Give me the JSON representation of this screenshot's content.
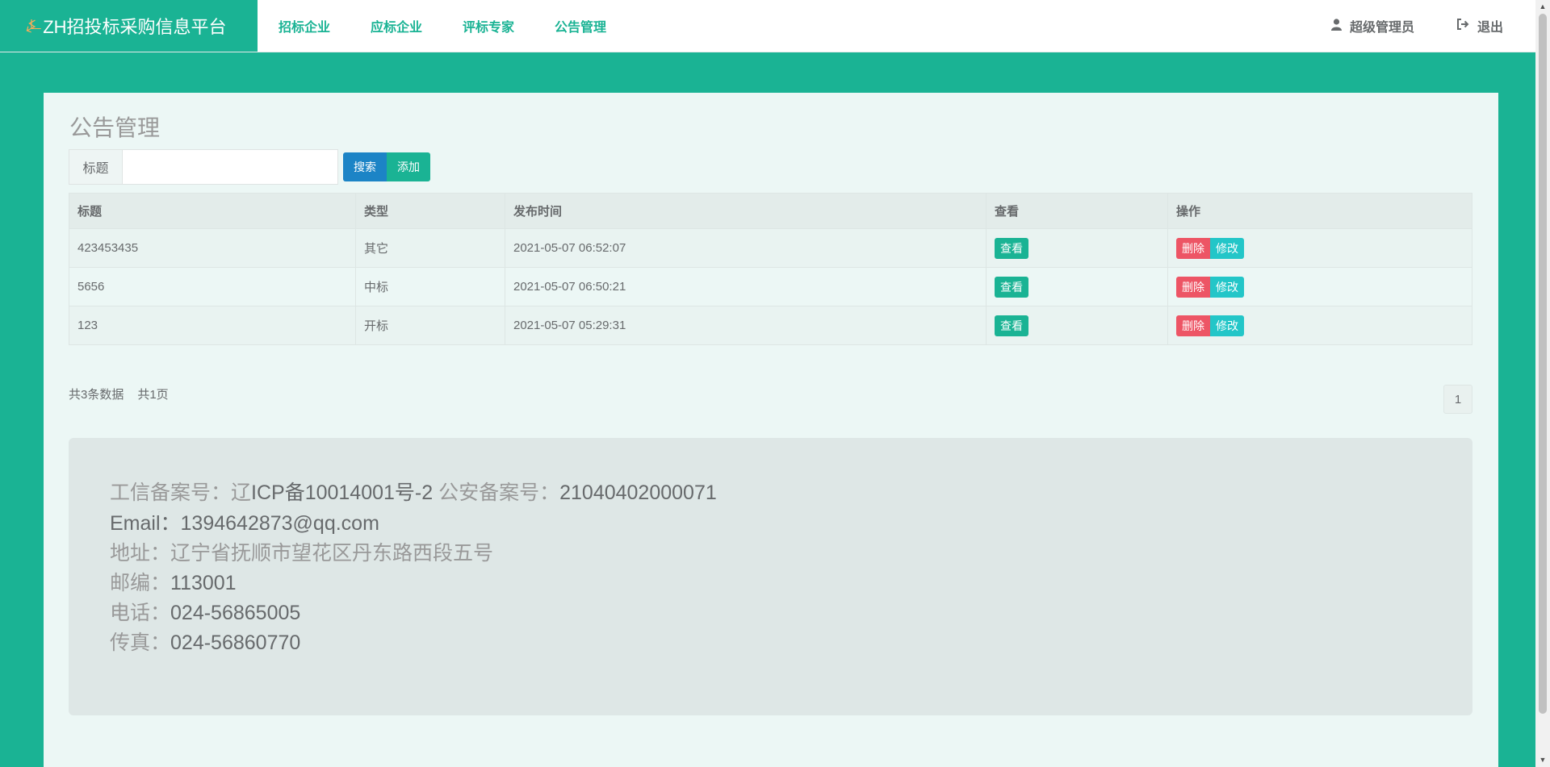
{
  "brand": {
    "title": "ZH招投标采购信息平台",
    "logo": "⍼"
  },
  "nav": [
    {
      "label": "招标企业"
    },
    {
      "label": "应标企业"
    },
    {
      "label": "评标专家"
    },
    {
      "label": "公告管理"
    }
  ],
  "user": {
    "name": "超级管理员",
    "logout": "退出"
  },
  "page": {
    "title": "公告管理"
  },
  "search": {
    "label": "标题",
    "value": "",
    "search_btn": "搜索",
    "add_btn": "添加"
  },
  "table": {
    "headers": [
      "标题",
      "类型",
      "发布时间",
      "查看",
      "操作"
    ],
    "rows": [
      {
        "title": "423453435",
        "type": "其它",
        "time": "2021-05-07 06:52:07",
        "view": "查看",
        "delete": "删除",
        "edit": "修改"
      },
      {
        "title": "5656",
        "type": "中标",
        "time": "2021-05-07 06:50:21",
        "view": "查看",
        "delete": "删除",
        "edit": "修改"
      },
      {
        "title": "123",
        "type": "开标",
        "time": "2021-05-07 05:29:31",
        "view": "查看",
        "delete": "删除",
        "edit": "修改"
      }
    ]
  },
  "pagination": {
    "total_records": "共3条数据",
    "total_pages": "共1页",
    "current": "1"
  },
  "footer": {
    "icp_label": "工信备案号：辽",
    "icp_value": "ICP备10014001号-2",
    "police_label": " 公安备案号：",
    "police_value": "21040402000071",
    "email_label": "Email：",
    "email_value": "1394642873@qq.com",
    "address": "地址：辽宁省抚顺市望花区丹东路西段五号",
    "postcode_label": "邮编：",
    "postcode_value": "113001",
    "phone_label": "电话：",
    "phone_value": "024-56865005",
    "fax_label": "传真：",
    "fax_value": "024-56860770"
  },
  "colors": {
    "primary": "#1ab394",
    "blue": "#1c84c6",
    "danger": "#ed5565",
    "info": "#23c6c8"
  }
}
